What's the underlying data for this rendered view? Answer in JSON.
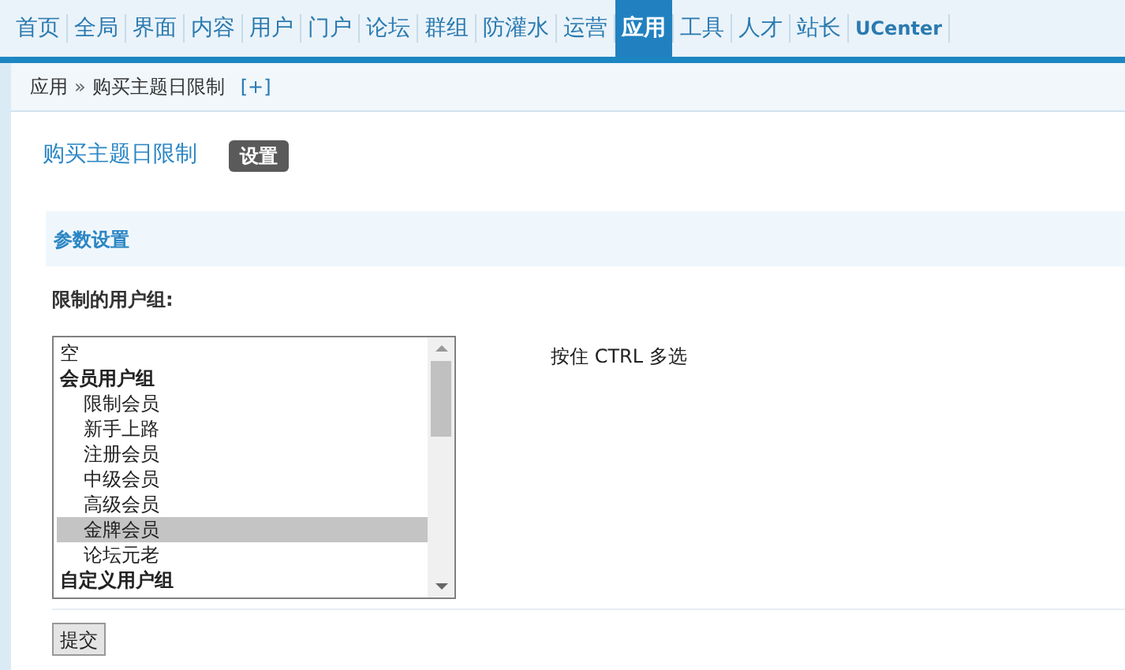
{
  "nav": [
    {
      "label": "首页",
      "selected": false
    },
    {
      "label": "全局",
      "selected": false
    },
    {
      "label": "界面",
      "selected": false
    },
    {
      "label": "内容",
      "selected": false
    },
    {
      "label": "用户",
      "selected": false
    },
    {
      "label": "门户",
      "selected": false
    },
    {
      "label": "论坛",
      "selected": false
    },
    {
      "label": "群组",
      "selected": false
    },
    {
      "label": "防灌水",
      "selected": false
    },
    {
      "label": "运营",
      "selected": false
    },
    {
      "label": "应用",
      "selected": true
    },
    {
      "label": "工具",
      "selected": false
    },
    {
      "label": "人才",
      "selected": false
    },
    {
      "label": "站长",
      "selected": false
    },
    {
      "label": "UCenter",
      "selected": false
    }
  ],
  "breadcrumb": {
    "items": [
      "应用",
      "购买主题日限制"
    ],
    "separator": "»",
    "add": "[+]"
  },
  "page_title": "购买主题日限制",
  "title_tag": "设置",
  "section_title": "参数设置",
  "field_label": "限制的用户组:",
  "options": [
    {
      "label": "空",
      "kind": "option",
      "selected": false
    },
    {
      "label": "会员用户组",
      "kind": "group",
      "selected": false
    },
    {
      "label": "限制会员",
      "kind": "sub",
      "selected": false
    },
    {
      "label": "新手上路",
      "kind": "sub",
      "selected": false
    },
    {
      "label": "注册会员",
      "kind": "sub",
      "selected": false
    },
    {
      "label": "中级会员",
      "kind": "sub",
      "selected": false
    },
    {
      "label": "高级会员",
      "kind": "sub",
      "selected": false
    },
    {
      "label": "金牌会员",
      "kind": "sub",
      "selected": true
    },
    {
      "label": "论坛元老",
      "kind": "sub",
      "selected": false
    },
    {
      "label": "自定义用户组",
      "kind": "group",
      "selected": false
    }
  ],
  "hint": "按住 CTRL 多选",
  "submit": "提交"
}
